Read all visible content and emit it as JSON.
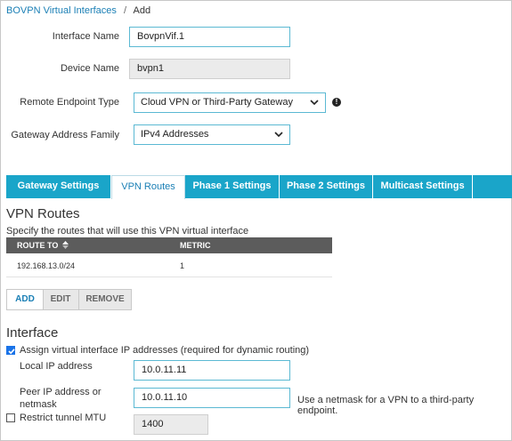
{
  "breadcrumb": {
    "parent": "BOVPN Virtual Interfaces",
    "separator": "/",
    "current": "Add"
  },
  "form": {
    "interface_name_label": "Interface Name",
    "interface_name_value": "BovpnVif.1",
    "device_name_label": "Device Name",
    "device_name_value": "bvpn1",
    "remote_endpoint_label": "Remote Endpoint Type",
    "remote_endpoint_value": "Cloud VPN or Third-Party Gateway",
    "gateway_family_label": "Gateway Address Family",
    "gateway_family_value": "IPv4 Addresses"
  },
  "tabs": [
    {
      "label": "Gateway Settings",
      "active": false
    },
    {
      "label": "VPN Routes",
      "active": true
    },
    {
      "label": "Phase 1 Settings",
      "active": false
    },
    {
      "label": "Phase 2 Settings",
      "active": false
    },
    {
      "label": "Multicast Settings",
      "active": false
    }
  ],
  "routes": {
    "title": "VPN Routes",
    "description": "Specify the routes that will use this VPN virtual interface",
    "columns": [
      "ROUTE TO",
      "METRIC"
    ],
    "rows": [
      {
        "route_to": "192.168.13.0/24",
        "metric": "1"
      }
    ],
    "buttons": {
      "add": "ADD",
      "edit": "EDIT",
      "remove": "REMOVE"
    }
  },
  "interface": {
    "title": "Interface",
    "assign_ip_label": "Assign virtual interface IP addresses (required for dynamic routing)",
    "assign_ip_checked": true,
    "local_ip_label": "Local IP address",
    "local_ip_value": "10.0.11.11",
    "peer_ip_label_line1": "Peer IP address or",
    "peer_ip_label_line2": "netmask",
    "peer_ip_value": "10.0.11.10",
    "peer_ip_hint": "Use a netmask for a VPN to a third-party endpoint.",
    "restrict_mtu_label": "Restrict tunnel MTU",
    "restrict_mtu_checked": false,
    "mtu_value": "1400"
  },
  "colors": {
    "accent": "#1aa5c9",
    "link": "#1a7fb5",
    "header_dark": "#5c5c5c",
    "input_border": "#5bb9d3"
  }
}
